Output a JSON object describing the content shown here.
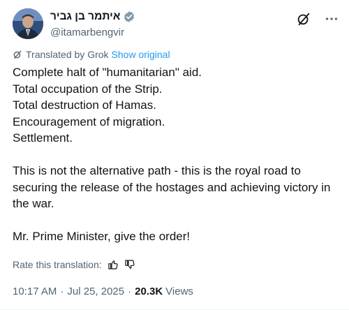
{
  "author": {
    "display_name": "איתמר בן גביר",
    "handle": "@itamarbengvir",
    "verified_icon": "verified-badge-icon",
    "avatar": "avatar"
  },
  "header_actions": {
    "grok_icon": "grok-icon",
    "more_icon": "more-options-icon"
  },
  "translation": {
    "label": "Translated by Grok",
    "show_original": "Show original"
  },
  "post": {
    "lines_block1": [
      "Complete halt of \"humanitarian\" aid.",
      "Total occupation of the Strip.",
      "Total destruction of Hamas.",
      "Encouragement of migration.",
      "Settlement."
    ],
    "paragraph2": "This is not the alternative path - this is the royal road to securing the release of the hostages and achieving victory in the war.",
    "paragraph3": "Mr. Prime Minister, give the order!"
  },
  "rating": {
    "label": "Rate this translation:"
  },
  "meta": {
    "time": "10:17 AM",
    "date": "Jul 25, 2025",
    "views_count": "20.3K",
    "views_label": "Views",
    "separator": "·"
  },
  "colors": {
    "text": "#0f1419",
    "secondary": "#536471",
    "link": "#1d9bf0",
    "verified": "#829aab"
  }
}
